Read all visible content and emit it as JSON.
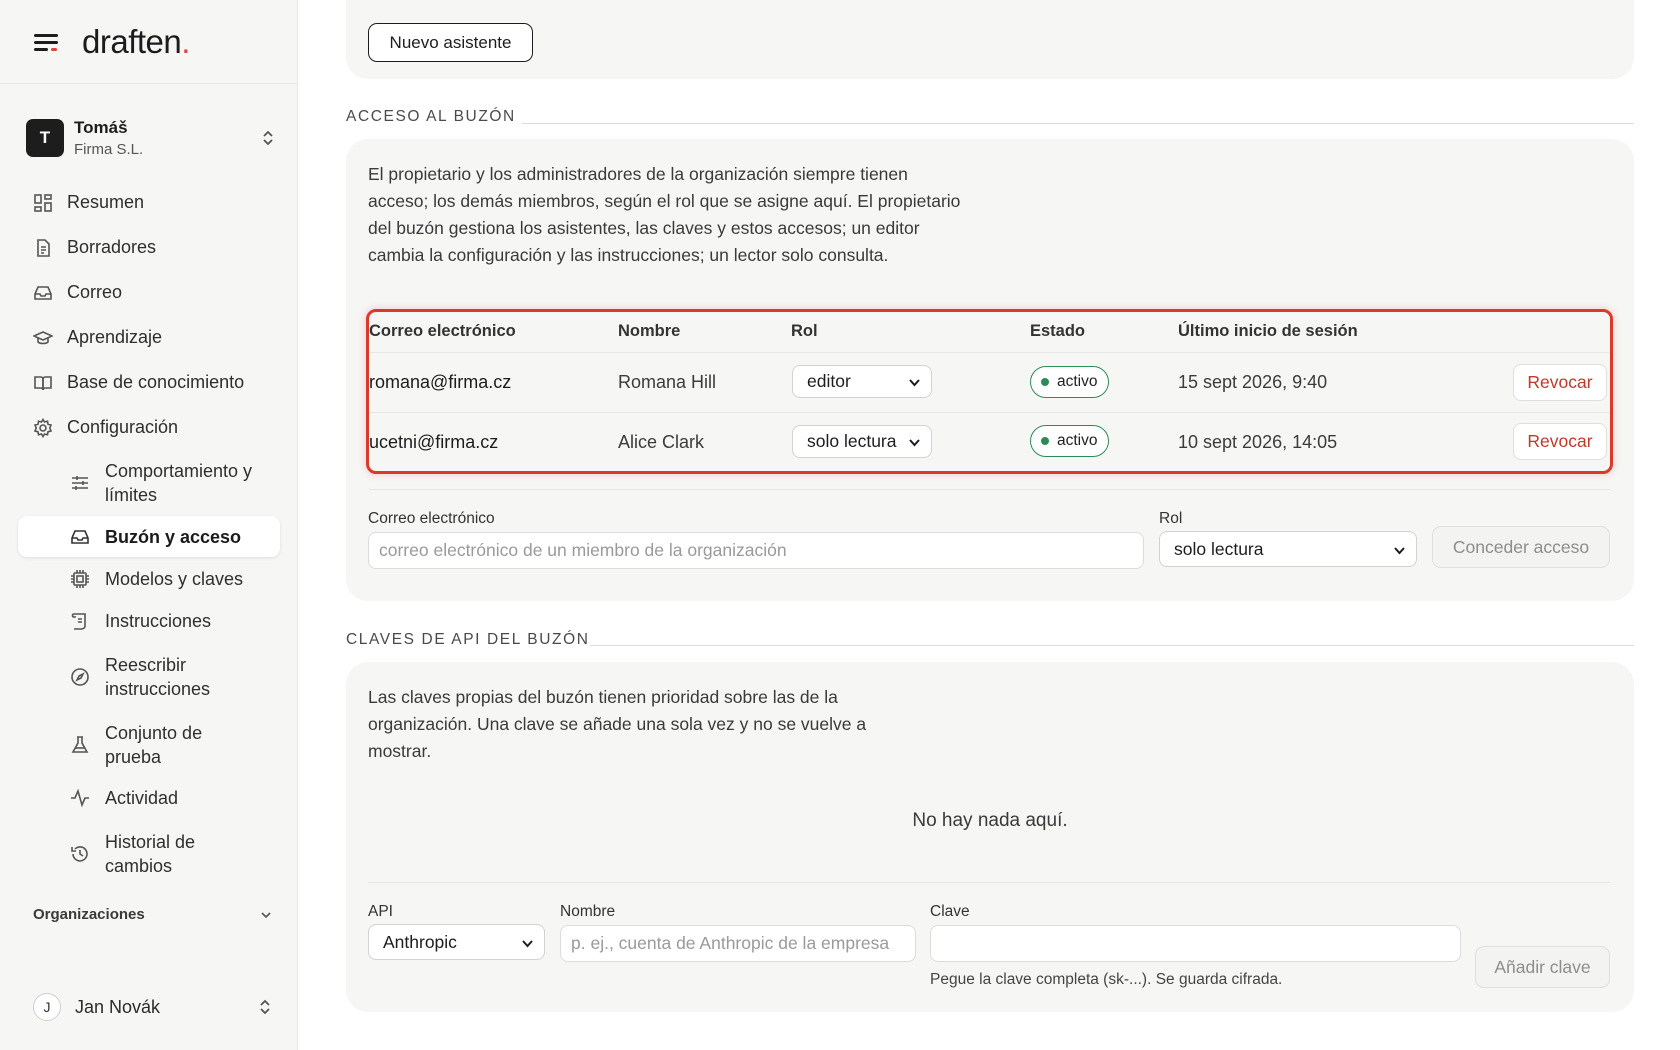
{
  "brand": {
    "logo_text": "draften",
    "logo_dot": "."
  },
  "account": {
    "initial": "T",
    "name": "Tomáš",
    "org": "Firma S.L."
  },
  "nav": {
    "items": [
      {
        "label": "Resumen",
        "icon": "grid-icon"
      },
      {
        "label": "Borradores",
        "icon": "document-icon"
      },
      {
        "label": "Correo",
        "icon": "inbox-icon"
      },
      {
        "label": "Aprendizaje",
        "icon": "graduation-cap-icon"
      },
      {
        "label": "Base de conocimiento",
        "icon": "book-icon"
      },
      {
        "label": "Configuración",
        "icon": "gear-icon"
      }
    ],
    "sub": [
      {
        "label": "Comportamiento y límites",
        "icon": "sliders-icon"
      },
      {
        "label": "Buzón y acceso",
        "icon": "inbox-icon"
      },
      {
        "label": "Modelos y claves",
        "icon": "cpu-icon"
      },
      {
        "label": "Instrucciones",
        "icon": "scroll-icon"
      },
      {
        "label": "Reescribir instrucciones",
        "icon": "compass-icon"
      },
      {
        "label": "Conjunto de prueba",
        "icon": "flask-icon"
      },
      {
        "label": "Actividad",
        "icon": "activity-icon"
      },
      {
        "label": "Historial de cambios",
        "icon": "history-icon"
      }
    ],
    "organizations_label": "Organizaciones"
  },
  "user": {
    "initial": "J",
    "name": "Jan Novák"
  },
  "top": {
    "new_assistant_label": "Nuevo asistente"
  },
  "access": {
    "section_title": "ACCESO AL BUZÓN",
    "description": "El propietario y los administradores de la organización siempre tienen acceso; los demás miembros, según el rol que se asigne aquí. El propietario del buzón gestiona los asistentes, las claves y estos accesos; un editor cambia la configuración y las instrucciones; un lector solo consulta.",
    "columns": [
      "Correo electrónico",
      "Nombre",
      "Rol",
      "Estado",
      "Último inicio de sesión"
    ],
    "rows": [
      {
        "email": "romana@firma.cz",
        "name": "Romana Hill",
        "role": "editor",
        "status": "activo",
        "last_login": "15 sept 2026, 9:40",
        "action": "Revocar"
      },
      {
        "email": "ucetni@firma.cz",
        "name": "Alice Clark",
        "role": "solo lectura",
        "status": "activo",
        "last_login": "10 sept 2026, 14:05",
        "action": "Revocar"
      }
    ],
    "form": {
      "email_label": "Correo electrónico",
      "email_placeholder": "correo electrónico de un miembro de la organización",
      "role_label": "Rol",
      "role_value": "solo lectura",
      "submit_label": "Conceder acceso"
    }
  },
  "keys": {
    "section_title": "CLAVES DE API DEL BUZÓN",
    "description": "Las claves propias del buzón tienen prioridad sobre las de la organización. Una clave se añade una sola vez y no se vuelve a mostrar.",
    "empty": "No hay nada aquí.",
    "form": {
      "api_label": "API",
      "api_value": "Anthropic",
      "name_label": "Nombre",
      "name_placeholder": "p. ej., cuenta de Anthropic de la empresa",
      "key_label": "Clave",
      "key_hint": "Pegue la clave completa (sk-...). Se guarda cifrada.",
      "submit_label": "Añadir clave"
    }
  },
  "colors": {
    "accent_red": "#d93a2b",
    "status_green": "#2e8b57",
    "revoke_red": "#c0392b"
  }
}
